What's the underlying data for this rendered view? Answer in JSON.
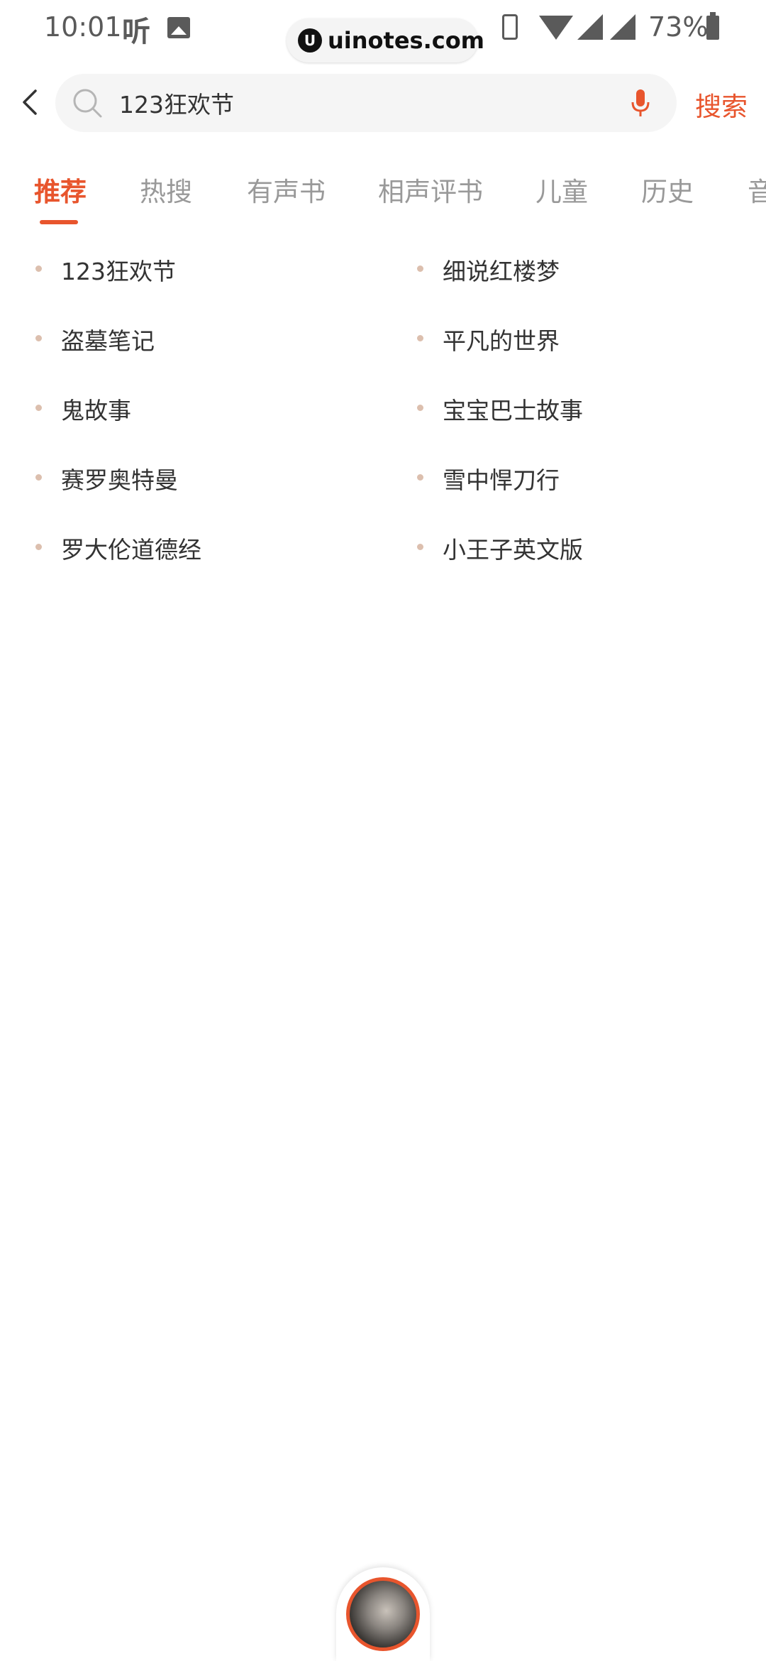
{
  "status_bar": {
    "time": "10:01",
    "app_icon_text": "听",
    "watermark": "uinotes.com",
    "battery": "73%"
  },
  "search": {
    "value": "123狂欢节",
    "button_label": "搜索"
  },
  "tabs": [
    {
      "label": "推荐",
      "active": true
    },
    {
      "label": "热搜"
    },
    {
      "label": "有声书"
    },
    {
      "label": "相声评书"
    },
    {
      "label": "儿童"
    },
    {
      "label": "历史"
    },
    {
      "label": "音"
    }
  ],
  "suggestions": {
    "left": [
      "123狂欢节",
      "盗墓笔记",
      "鬼故事",
      "赛罗奥特曼",
      "罗大伦道德经"
    ],
    "right": [
      "细说红楼梦",
      "平凡的世界",
      "宝宝巴士故事",
      "雪中悍刀行",
      "小王子英文版"
    ]
  },
  "colors": {
    "accent": "#e8552d",
    "bullet": "#dcbfae"
  }
}
